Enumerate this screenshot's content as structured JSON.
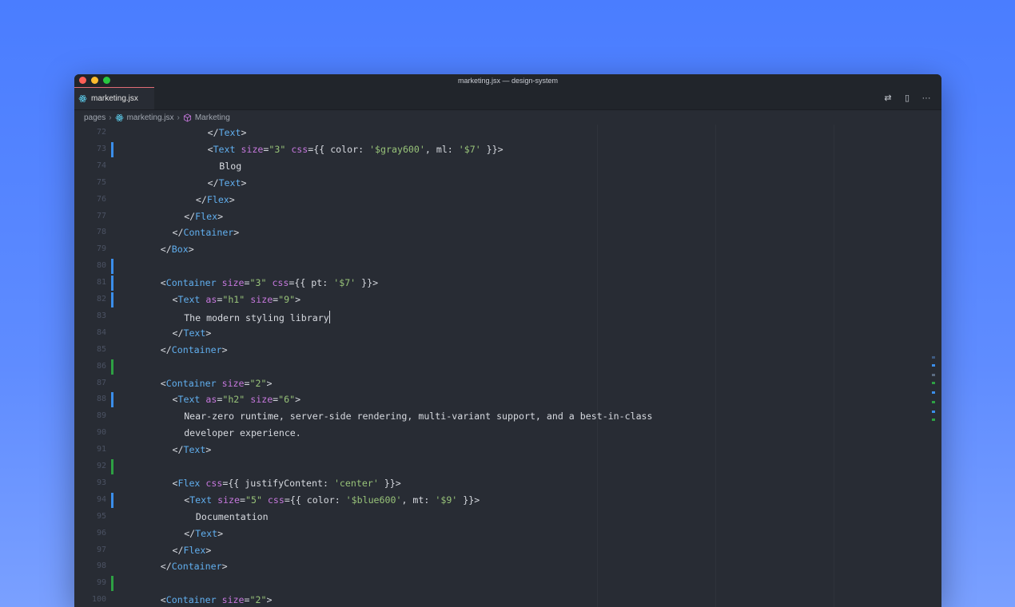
{
  "window": {
    "title": "marketing.jsx — design-system"
  },
  "tab": {
    "label": "marketing.jsx",
    "icon": "react-icon"
  },
  "actions": [
    {
      "name": "compare-changes-button",
      "icon": "compare-icon",
      "glyph": "⇄"
    },
    {
      "name": "split-editor-button",
      "icon": "split-icon",
      "glyph": "▯"
    },
    {
      "name": "more-actions-button",
      "icon": "more-icon",
      "glyph": "···"
    }
  ],
  "breadcrumb": {
    "folder": "pages",
    "file": "marketing.jsx",
    "symbol": "Marketing"
  },
  "colors": {
    "tag": "#61afef",
    "attr": "#c678dd",
    "string": "#98c379",
    "modified": "#3b8eea",
    "added": "#2ea043"
  },
  "lines": [
    {
      "n": "72",
      "indent": 8,
      "mark": "",
      "code": [
        [
          "p",
          "</"
        ],
        [
          "t",
          "Text"
        ],
        [
          "p",
          ">"
        ]
      ]
    },
    {
      "n": "73",
      "indent": 8,
      "mark": "modified",
      "code": [
        [
          "p",
          "<"
        ],
        [
          "t",
          "Text"
        ],
        [
          "p",
          " "
        ],
        [
          "a",
          "size"
        ],
        [
          "p",
          "="
        ],
        [
          "s",
          "\"3\""
        ],
        [
          "p",
          " "
        ],
        [
          "a",
          "css"
        ],
        [
          "p",
          "={{ color: "
        ],
        [
          "s",
          "'$gray600'"
        ],
        [
          "p",
          ", ml: "
        ],
        [
          "s",
          "'$7'"
        ],
        [
          "p",
          " }}>"
        ]
      ]
    },
    {
      "n": "74",
      "indent": 9,
      "mark": "",
      "code": [
        [
          "p",
          "Blog"
        ]
      ]
    },
    {
      "n": "75",
      "indent": 8,
      "mark": "",
      "code": [
        [
          "p",
          "</"
        ],
        [
          "t",
          "Text"
        ],
        [
          "p",
          ">"
        ]
      ]
    },
    {
      "n": "76",
      "indent": 7,
      "mark": "",
      "code": [
        [
          "p",
          "</"
        ],
        [
          "t",
          "Flex"
        ],
        [
          "p",
          ">"
        ]
      ]
    },
    {
      "n": "77",
      "indent": 6,
      "mark": "",
      "code": [
        [
          "p",
          "</"
        ],
        [
          "t",
          "Flex"
        ],
        [
          "p",
          ">"
        ]
      ]
    },
    {
      "n": "78",
      "indent": 5,
      "mark": "",
      "code": [
        [
          "p",
          "</"
        ],
        [
          "t",
          "Container"
        ],
        [
          "p",
          ">"
        ]
      ]
    },
    {
      "n": "79",
      "indent": 4,
      "mark": "",
      "code": [
        [
          "p",
          "</"
        ],
        [
          "t",
          "Box"
        ],
        [
          "p",
          ">"
        ]
      ]
    },
    {
      "n": "80",
      "indent": 4,
      "mark": "modified",
      "code": []
    },
    {
      "n": "81",
      "indent": 4,
      "mark": "modified",
      "code": [
        [
          "p",
          "<"
        ],
        [
          "t",
          "Container"
        ],
        [
          "p",
          " "
        ],
        [
          "a",
          "size"
        ],
        [
          "p",
          "="
        ],
        [
          "s",
          "\"3\""
        ],
        [
          "p",
          " "
        ],
        [
          "a",
          "css"
        ],
        [
          "p",
          "={{ pt: "
        ],
        [
          "s",
          "'$7'"
        ],
        [
          "p",
          " }}>"
        ]
      ]
    },
    {
      "n": "82",
      "indent": 5,
      "mark": "modified",
      "code": [
        [
          "p",
          "<"
        ],
        [
          "t",
          "Text"
        ],
        [
          "p",
          " "
        ],
        [
          "a",
          "as"
        ],
        [
          "p",
          "="
        ],
        [
          "s",
          "\"h1\""
        ],
        [
          "p",
          " "
        ],
        [
          "a",
          "size"
        ],
        [
          "p",
          "="
        ],
        [
          "s",
          "\"9\""
        ],
        [
          "p",
          ">"
        ]
      ]
    },
    {
      "n": "83",
      "indent": 6,
      "mark": "",
      "code": [
        [
          "p",
          "The modern styling library"
        ]
      ],
      "cursor": true
    },
    {
      "n": "84",
      "indent": 5,
      "mark": "",
      "code": [
        [
          "p",
          "</"
        ],
        [
          "t",
          "Text"
        ],
        [
          "p",
          ">"
        ]
      ]
    },
    {
      "n": "85",
      "indent": 4,
      "mark": "",
      "code": [
        [
          "p",
          "</"
        ],
        [
          "t",
          "Container"
        ],
        [
          "p",
          ">"
        ]
      ]
    },
    {
      "n": "86",
      "indent": 4,
      "mark": "added",
      "code": []
    },
    {
      "n": "87",
      "indent": 4,
      "mark": "",
      "code": [
        [
          "p",
          "<"
        ],
        [
          "t",
          "Container"
        ],
        [
          "p",
          " "
        ],
        [
          "a",
          "size"
        ],
        [
          "p",
          "="
        ],
        [
          "s",
          "\"2\""
        ],
        [
          "p",
          ">"
        ]
      ]
    },
    {
      "n": "88",
      "indent": 5,
      "mark": "modified",
      "code": [
        [
          "p",
          "<"
        ],
        [
          "t",
          "Text"
        ],
        [
          "p",
          " "
        ],
        [
          "a",
          "as"
        ],
        [
          "p",
          "="
        ],
        [
          "s",
          "\"h2\""
        ],
        [
          "p",
          " "
        ],
        [
          "a",
          "size"
        ],
        [
          "p",
          "="
        ],
        [
          "s",
          "\"6\""
        ],
        [
          "p",
          ">"
        ]
      ]
    },
    {
      "n": "89",
      "indent": 6,
      "mark": "",
      "code": [
        [
          "p",
          "Near-zero runtime, server-side rendering, multi-variant support, and a best-in-class"
        ]
      ]
    },
    {
      "n": "90",
      "indent": 6,
      "mark": "",
      "code": [
        [
          "p",
          "developer experience."
        ]
      ]
    },
    {
      "n": "91",
      "indent": 5,
      "mark": "",
      "code": [
        [
          "p",
          "</"
        ],
        [
          "t",
          "Text"
        ],
        [
          "p",
          ">"
        ]
      ]
    },
    {
      "n": "92",
      "indent": 5,
      "mark": "added",
      "code": []
    },
    {
      "n": "93",
      "indent": 5,
      "mark": "",
      "code": [
        [
          "p",
          "<"
        ],
        [
          "t",
          "Flex"
        ],
        [
          "p",
          " "
        ],
        [
          "a",
          "css"
        ],
        [
          "p",
          "={{ justifyContent: "
        ],
        [
          "s",
          "'center'"
        ],
        [
          "p",
          " }}>"
        ]
      ]
    },
    {
      "n": "94",
      "indent": 6,
      "mark": "modified",
      "code": [
        [
          "p",
          "<"
        ],
        [
          "t",
          "Text"
        ],
        [
          "p",
          " "
        ],
        [
          "a",
          "size"
        ],
        [
          "p",
          "="
        ],
        [
          "s",
          "\"5\""
        ],
        [
          "p",
          " "
        ],
        [
          "a",
          "css"
        ],
        [
          "p",
          "={{ color: "
        ],
        [
          "s",
          "'$blue600'"
        ],
        [
          "p",
          ", mt: "
        ],
        [
          "s",
          "'$9'"
        ],
        [
          "p",
          " }}>"
        ]
      ]
    },
    {
      "n": "95",
      "indent": 7,
      "mark": "",
      "code": [
        [
          "p",
          "Documentation"
        ]
      ]
    },
    {
      "n": "96",
      "indent": 6,
      "mark": "",
      "code": [
        [
          "p",
          "</"
        ],
        [
          "t",
          "Text"
        ],
        [
          "p",
          ">"
        ]
      ]
    },
    {
      "n": "97",
      "indent": 5,
      "mark": "",
      "code": [
        [
          "p",
          "</"
        ],
        [
          "t",
          "Flex"
        ],
        [
          "p",
          ">"
        ]
      ]
    },
    {
      "n": "98",
      "indent": 4,
      "mark": "",
      "code": [
        [
          "p",
          "</"
        ],
        [
          "t",
          "Container"
        ],
        [
          "p",
          ">"
        ]
      ]
    },
    {
      "n": "99",
      "indent": 4,
      "mark": "added",
      "code": []
    },
    {
      "n": "100",
      "indent": 4,
      "mark": "",
      "code": [
        [
          "p",
          "<"
        ],
        [
          "t",
          "Container"
        ],
        [
          "p",
          " "
        ],
        [
          "a",
          "size"
        ],
        [
          "p",
          "="
        ],
        [
          "s",
          "\"2\""
        ],
        [
          "p",
          ">"
        ]
      ]
    }
  ]
}
